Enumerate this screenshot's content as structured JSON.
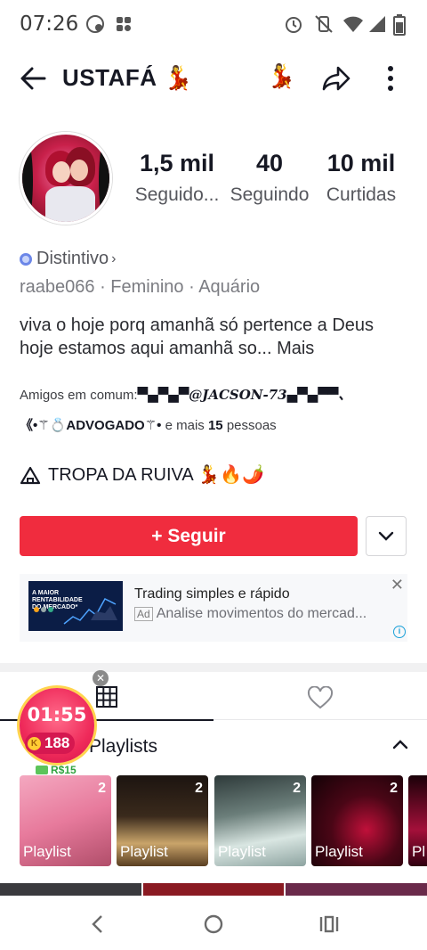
{
  "status_bar": {
    "time": "07:26"
  },
  "header": {
    "title": "USTAFÁ 💃",
    "emoji_button": "💃"
  },
  "profile": {
    "stats": [
      {
        "value": "1,5 mil",
        "label": "Seguido..."
      },
      {
        "value": "40",
        "label": "Seguindo"
      },
      {
        "value": "10 mil",
        "label": "Curtidas"
      }
    ],
    "badge_label": "Distintivo",
    "meta": "raabe066 · Feminino · Aquário",
    "bio": "viva o hoje porq amanhã só pertence a Deus hoje estamos aqui amanhã so...",
    "bio_more": "Mais",
    "mutual_prefix": "Amigos em comum:",
    "mutual_friend_1": "▀▄▀▄▀@JACSON-73▄▀▄▀▀、",
    "mutual_friend_2": "《•⚚💍ADVOGADO⚚•",
    "mutual_suffix_1": "e mais",
    "mutual_count": "15",
    "mutual_suffix_2": "pessoas",
    "group": "TROPA DA RUIVA 💃🔥🌶️"
  },
  "actions": {
    "follow_label": "+ Seguir"
  },
  "ad": {
    "thumb_text": "A MAIOR RENTABILIDADE DO MERCADO*",
    "title": "Trading simples e rápido",
    "ad_tag": "Ad",
    "description": "Analise movimentos do mercad..."
  },
  "timer": {
    "time": "01:55",
    "coins": "188",
    "reward": "R$15"
  },
  "playlists": {
    "header": "Playlists",
    "items": [
      {
        "label": "Playlist",
        "count": "2"
      },
      {
        "label": "Playlist",
        "count": "2"
      },
      {
        "label": "Playlist",
        "count": "2"
      },
      {
        "label": "Playlist",
        "count": "2"
      },
      {
        "label": "Pl",
        "count": ""
      }
    ]
  },
  "colors": {
    "accent": "#f02c3e",
    "text": "#161823",
    "muted": "#7b7c82"
  }
}
